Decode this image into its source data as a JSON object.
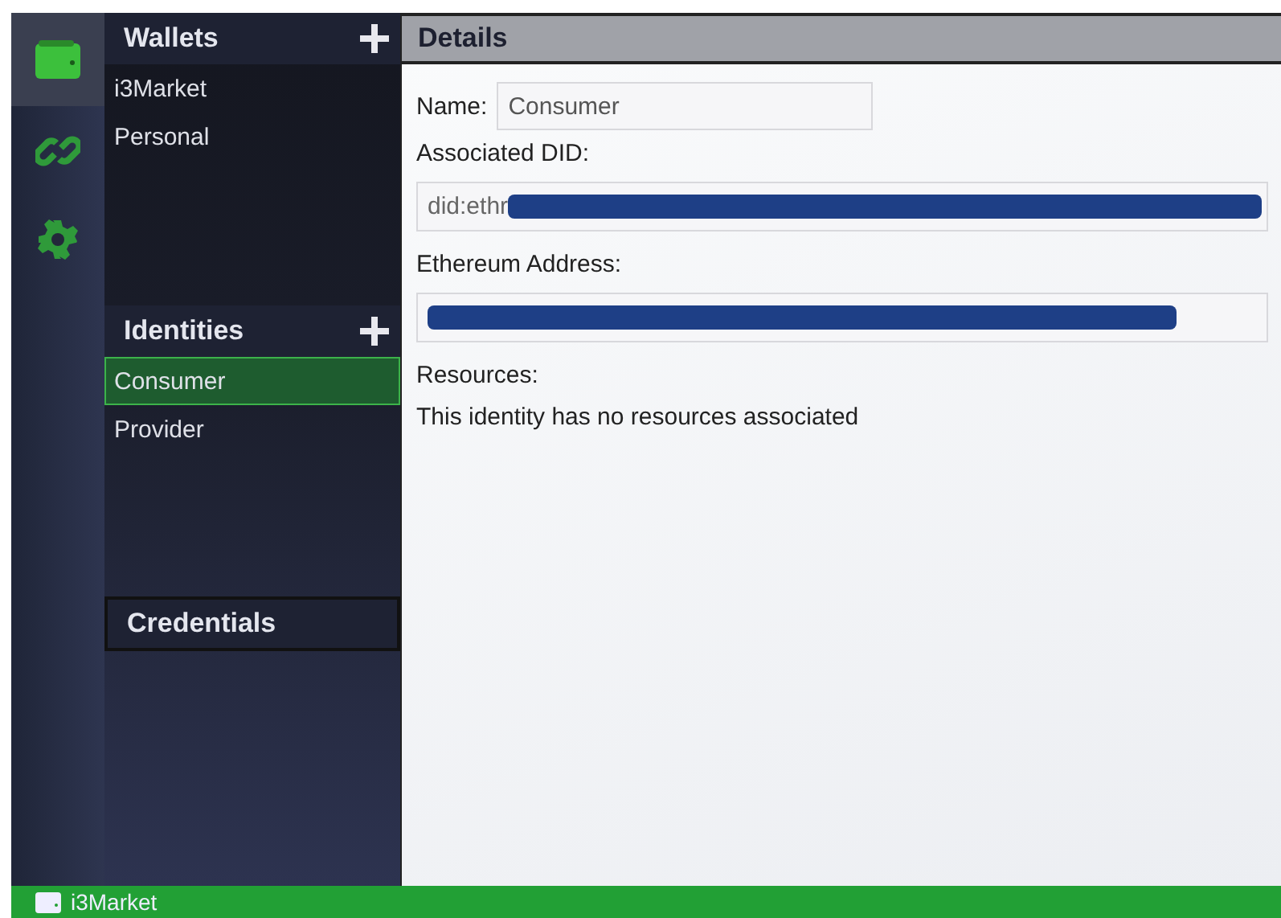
{
  "nav": [
    {
      "kind": "wallet",
      "selected": true
    },
    {
      "kind": "link",
      "selected": false
    },
    {
      "kind": "settings",
      "selected": false
    }
  ],
  "wallets": {
    "title": "Wallets",
    "items": [
      {
        "label": "i3Market",
        "selected": false
      },
      {
        "label": "Personal",
        "selected": false
      }
    ]
  },
  "identities": {
    "title": "Identities",
    "items": [
      {
        "label": "Consumer",
        "selected": true
      },
      {
        "label": "Provider",
        "selected": false
      }
    ]
  },
  "credentials": {
    "title": "Credentials"
  },
  "details": {
    "title": "Details",
    "name_label": "Name:",
    "name_value": "Consumer",
    "did_label": "Associated DID:",
    "did_value": "did:ethr",
    "address_label": "Ethereum Address:",
    "resources_label": "Resources:",
    "resources_text": "This identity has no resources associated"
  },
  "status_bar": {
    "wallet": "i3Market"
  }
}
